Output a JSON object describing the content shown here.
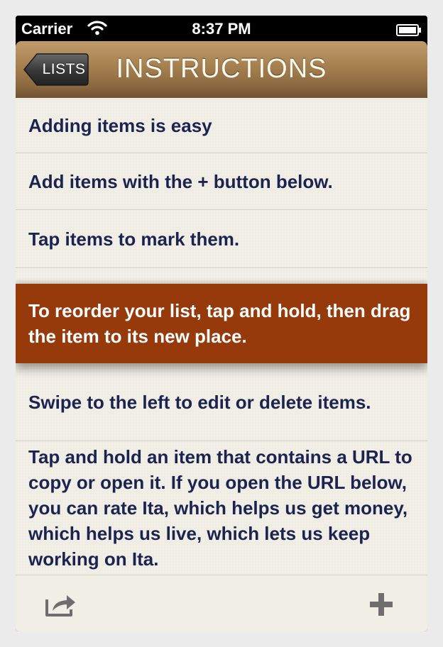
{
  "status_bar": {
    "carrier": "Carrier",
    "time": "8:37 PM",
    "wifi_icon": "wifi-icon",
    "battery_icon": "battery-icon"
  },
  "nav_bar": {
    "back_label": "LISTS",
    "title": "INSTRUCTIONS"
  },
  "list": {
    "items": [
      {
        "text": "Adding items is easy",
        "highlighted": false
      },
      {
        "text": "Add items with the + button below.",
        "highlighted": false
      },
      {
        "text": "Tap items to mark them.",
        "highlighted": false
      },
      {
        "text": "To reorder your list, tap and hold, then drag the item to its new place.",
        "highlighted": true
      },
      {
        "text": "Swipe to the left to edit or delete items.",
        "highlighted": false
      },
      {
        "text": "Tap and hold an item that contains a URL to copy or open it. If you open the URL below, you can rate Ita, which helps us get money, which helps us live, which lets us keep working on Ita.",
        "highlighted": false
      }
    ]
  },
  "toolbar": {
    "share_icon": "share-icon",
    "add_icon": "plus-icon"
  },
  "colors": {
    "text": "#1b2350",
    "highlight": "#963a0c",
    "background": "#f1eee6",
    "nav_bar": "#a5804f"
  }
}
